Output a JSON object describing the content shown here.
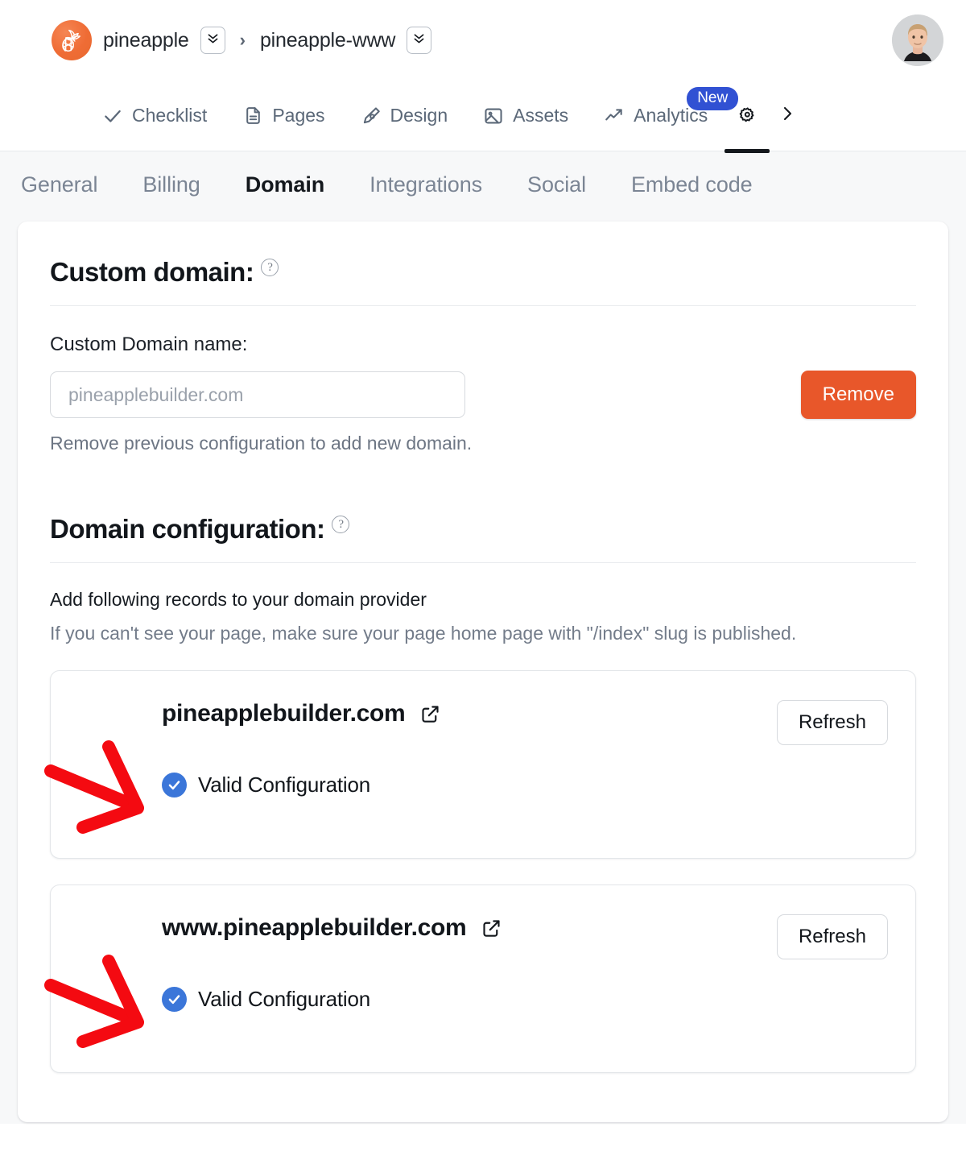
{
  "header": {
    "workspace": "pineapple",
    "project": "pineapple-www",
    "separator": "›",
    "logo_icon": "pineapple-logo-icon",
    "workspace_dropdown_icon": "chevron-double-down-icon",
    "project_dropdown_icon": "chevron-double-down-icon",
    "avatar_icon": "user-avatar",
    "brand_color": "#ef6c35"
  },
  "mainnav": {
    "items": [
      {
        "label": "Checklist",
        "icon": "check-icon",
        "active": false
      },
      {
        "label": "Pages",
        "icon": "document-icon",
        "active": false
      },
      {
        "label": "Design",
        "icon": "pen-tool-icon",
        "active": false
      },
      {
        "label": "Assets",
        "icon": "image-icon",
        "active": false
      },
      {
        "label": "Analytics",
        "icon": "trend-up-icon",
        "active": false,
        "badge": "New"
      }
    ],
    "settings_icon": "gear-icon",
    "settings_active": true,
    "overflow_icon": "chevron-right-icon",
    "badge_color": "#3151d3"
  },
  "subnav": {
    "tabs": [
      {
        "label": "General",
        "active": false
      },
      {
        "label": "Billing",
        "active": false
      },
      {
        "label": "Domain",
        "active": true
      },
      {
        "label": "Integrations",
        "active": false
      },
      {
        "label": "Social",
        "active": false
      },
      {
        "label": "Embed code",
        "active": false
      }
    ]
  },
  "custom_domain": {
    "title": "Custom domain:",
    "help_icon": "question-mark-circle-icon",
    "field_label": "Custom Domain name:",
    "input_value": "",
    "input_placeholder": "pineapplebuilder.com",
    "remove_button": "Remove",
    "remove_button_color": "#e8572a",
    "hint": "Remove previous configuration to add new domain."
  },
  "domain_configuration": {
    "title": "Domain configuration:",
    "help_icon": "question-mark-circle-icon",
    "instruction": "Add following records to your domain provider",
    "note": "If you can't see your page, make sure your page home page with \"/index\" slug is published.",
    "records": [
      {
        "domain": "pineapplebuilder.com",
        "external_link_icon": "external-link-icon",
        "refresh_button": "Refresh",
        "status": "Valid Configuration",
        "status_icon": "check-circle-icon",
        "status_color": "#3b76d9",
        "annotation_icon": "red-arrow-annotation"
      },
      {
        "domain": "www.pineapplebuilder.com",
        "external_link_icon": "external-link-icon",
        "refresh_button": "Refresh",
        "status": "Valid Configuration",
        "status_icon": "check-circle-icon",
        "status_color": "#3b76d9",
        "annotation_icon": "red-arrow-annotation"
      }
    ]
  }
}
